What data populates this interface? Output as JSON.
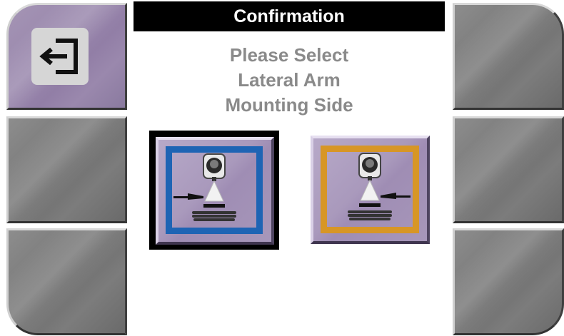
{
  "header": {
    "title": "Confirmation"
  },
  "prompt": {
    "lines": [
      "Please Select",
      "Lateral Arm",
      "Mounting Side"
    ]
  },
  "sidebar_left": {
    "buttons": [
      {
        "icon": "exit-icon",
        "color": "purple"
      },
      {
        "icon": null,
        "color": "gray"
      },
      {
        "icon": null,
        "color": "gray"
      }
    ]
  },
  "sidebar_right": {
    "buttons": [
      {
        "icon": null,
        "color": "gray"
      },
      {
        "icon": null,
        "color": "gray"
      },
      {
        "icon": null,
        "color": "gray"
      }
    ]
  },
  "choices": [
    {
      "side": "left",
      "icon": "lateral-arm-left-icon",
      "frame_color": "#1e64b4",
      "selected": true
    },
    {
      "side": "right",
      "icon": "lateral-arm-right-icon",
      "frame_color": "#d79626",
      "selected": false
    }
  ],
  "colors": {
    "title_bg": "#000000",
    "title_text": "#ffffff",
    "prompt_text": "#8a8a8a",
    "button_gray": "#7d7d7d",
    "button_purple": "#9a88ad"
  }
}
